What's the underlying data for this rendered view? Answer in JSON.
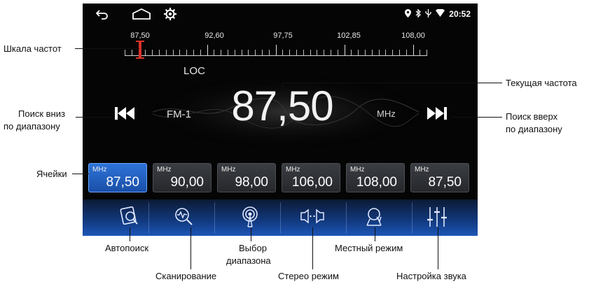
{
  "status": {
    "time": "20:52"
  },
  "scale": {
    "labels": [
      "87,50",
      "92,60",
      "97,75",
      "102,85",
      "108,00"
    ]
  },
  "radio": {
    "loc": "LOC",
    "band": "FM-1",
    "frequency": "87,50",
    "unit": "MHz"
  },
  "presets": [
    {
      "unit": "MHz",
      "value": "87,50",
      "active": true
    },
    {
      "unit": "MHz",
      "value": "90,00"
    },
    {
      "unit": "MHz",
      "value": "98,00"
    },
    {
      "unit": "MHz",
      "value": "106,00"
    },
    {
      "unit": "MHz",
      "value": "108,00"
    },
    {
      "unit": "MHz",
      "value": "87,50"
    }
  ],
  "annotations": {
    "scale": "Шкала частот",
    "current_freq": "Текущая частота",
    "seek_down_1": "Поиск вниз",
    "seek_down_2": "по диапазону",
    "seek_up_1": "Поиск вверх",
    "seek_up_2": "по диапазону",
    "cells": "Ячейки",
    "autosearch": "Автопоиск",
    "scanning": "Сканирование",
    "band_select_1": "Выбор",
    "band_select_2": "диапазона",
    "stereo": "Стерео режим",
    "local": "Местный режим",
    "sound": "Настройка звука"
  },
  "colors": {
    "accent": "#2d73d8",
    "needle": "#d8322a",
    "toolbar": "#1d56b8"
  }
}
